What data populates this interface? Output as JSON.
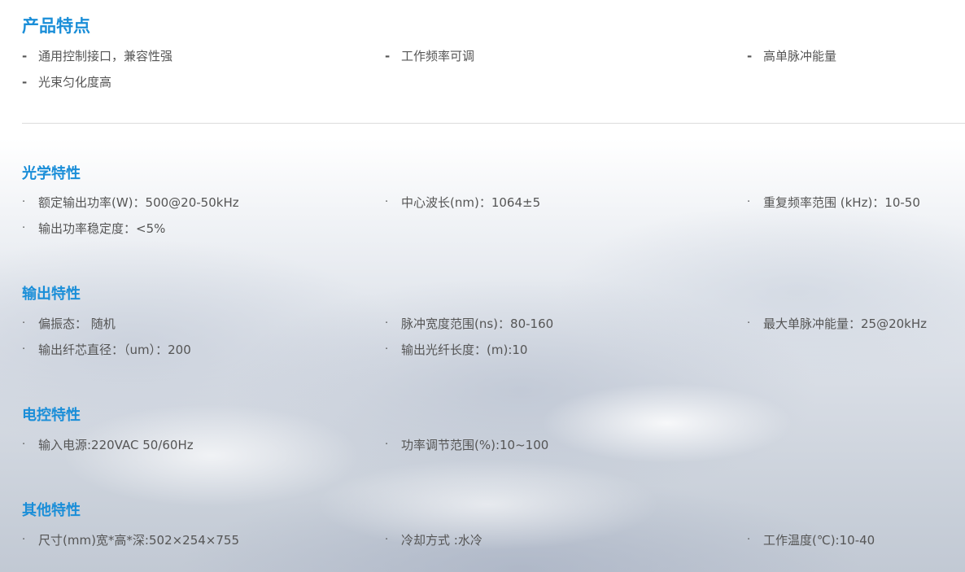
{
  "features": {
    "title": "产品特点",
    "items": [
      "通用控制接口，兼容性强",
      "工作频率可调",
      "高单脉冲能量",
      "光束匀化度高"
    ]
  },
  "optical": {
    "title": "光学特性",
    "items": [
      "额定输出功率(W)：500@20-50kHz",
      "中心波长(nm)：1064±5",
      "重复频率范围 (kHz)：10-50",
      "输出功率稳定度：<5%"
    ]
  },
  "output": {
    "title": "输出特性",
    "items": [
      "偏振态： 随机",
      "脉冲宽度范围(ns)：80-160",
      "最大单脉冲能量：25@20kHz",
      "输出纤芯直径：（um）：200",
      "输出光纤长度：(m):10"
    ]
  },
  "electric": {
    "title": "电控特性",
    "items": [
      "输入电源:220VAC 50/60Hz",
      "功率调节范围(%):10~100"
    ]
  },
  "other": {
    "title": "其他特性",
    "items": [
      "尺寸(mm)宽*高*深:502×254×755",
      "冷却方式 :水冷",
      "工作温度(℃):10-40"
    ]
  },
  "markers": {
    "dash": "-",
    "dot": "·"
  }
}
